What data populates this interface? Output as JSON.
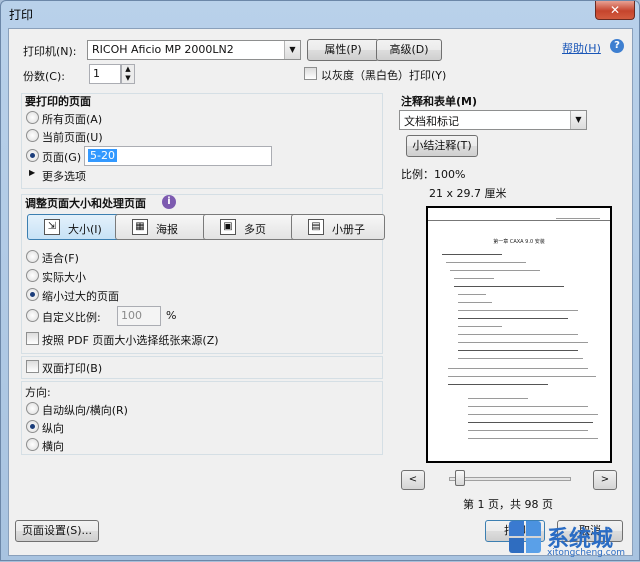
{
  "window": {
    "title": "打印",
    "close_glyph": "✕"
  },
  "printer": {
    "label": "打印机(N):",
    "selected": "RICOH Aficio MP 2000LN2",
    "properties_button": "属性(P)",
    "advanced_button": "高级(D)",
    "help_link": "帮助(H)"
  },
  "copies": {
    "label": "份数(C):",
    "value": "1"
  },
  "grayscale": {
    "label": "以灰度（黑白色）打印(Y)"
  },
  "pages_section": {
    "title": "要打印的页面",
    "options": {
      "all": "所有页面(A)",
      "current": "当前页面(U)",
      "pages": "页面(G)"
    },
    "range_value": "5-20",
    "more_options": "更多选项"
  },
  "sizing_section": {
    "title": "调整页面大小和处理页面",
    "info_glyph": "i",
    "buttons": {
      "size": "大小(I)",
      "poster": "海报",
      "multiple": "多页",
      "booklet": "小册子"
    },
    "options": {
      "fit": "适合(F)",
      "actual": "实际大小",
      "shrink": "缩小过大的页面",
      "custom": "自定义比例:"
    },
    "custom_scale_value": "100",
    "percent_sign": "%",
    "paper_source_label": "按照 PDF 页面大小选择纸张来源(Z)"
  },
  "duplex": {
    "label": "双面打印(B)"
  },
  "orientation": {
    "title": "方向:",
    "auto": "自动纵向/横向(R)",
    "portrait": "纵向",
    "landscape": "横向"
  },
  "comments": {
    "title": "注释和表单(M)",
    "selected": "文档和标记",
    "summarize_button": "小结注释(T)"
  },
  "preview": {
    "scale": "比例：100%",
    "paper_size": "21 x 29.7 厘米",
    "page_info": "第 1 页，共 98 页",
    "prev_glyph": "<",
    "next_glyph": ">",
    "slider_position": 0.05,
    "page_heading": "第一章 CAXA 9.0 安装"
  },
  "footer": {
    "page_setup_button": "页面设置(S)...",
    "print_button": "打印",
    "cancel_button": "取消"
  },
  "watermark": {
    "brand": "系统城",
    "url": "xitongcheng.com"
  },
  "colors": {
    "accent": "#1a56b7",
    "close": "#c5442d",
    "frame": "#b9d1ea"
  }
}
